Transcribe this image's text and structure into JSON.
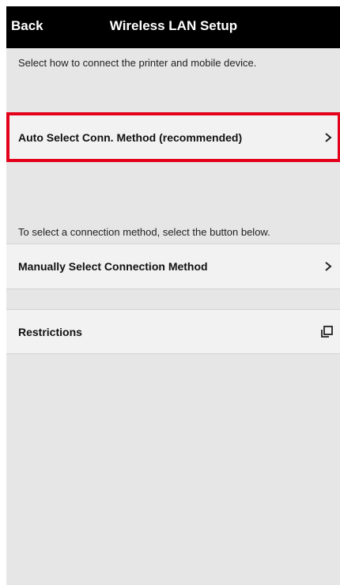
{
  "header": {
    "back_label": "Back",
    "title": "Wireless LAN Setup"
  },
  "intro_text": "Select how to connect the printer and mobile device.",
  "auto_select": {
    "label": "Auto Select Conn. Method (recommended)",
    "icon": "chevron-right-icon"
  },
  "manual_caption": "To select a connection method, select the button below.",
  "manual_select": {
    "label": "Manually Select Connection Method",
    "icon": "chevron-right-icon"
  },
  "restrictions": {
    "label": "Restrictions",
    "icon": "external-window-icon"
  },
  "colors": {
    "header_bg": "#000000",
    "highlight": "#e3001b",
    "screen_bg": "#e6e6e6",
    "row_bg": "#f2f2f2"
  }
}
